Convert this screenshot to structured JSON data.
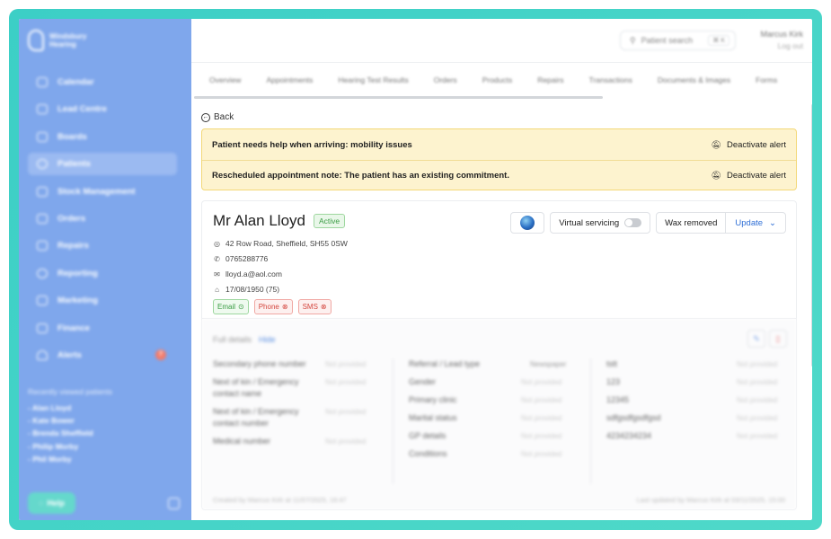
{
  "brand": {
    "name_line1": "Windsbury",
    "name_line2": "Hearing"
  },
  "sidebar": {
    "items": [
      {
        "label": "Calendar"
      },
      {
        "label": "Lead Centre"
      },
      {
        "label": "Boards"
      },
      {
        "label": "Patients"
      },
      {
        "label": "Stock Management"
      },
      {
        "label": "Orders"
      },
      {
        "label": "Repairs"
      },
      {
        "label": "Reporting"
      },
      {
        "label": "Marketing"
      },
      {
        "label": "Finance"
      },
      {
        "label": "Alerts",
        "badge": "7"
      }
    ],
    "recent_heading": "Recently viewed patients",
    "recent": [
      "- Alan Lloyd",
      "- Kate Bower",
      "- Brenda Sheffield",
      "- Philip Morby",
      "- Phil Morby"
    ],
    "help_label": "Help"
  },
  "header": {
    "search_placeholder": "Patient search",
    "search_shortcut": "⌘ K",
    "user_name": "Marcus Kirk",
    "logout_label": "Log out"
  },
  "tabs": [
    "Overview",
    "Appointments",
    "Hearing Test Results",
    "Orders",
    "Products",
    "Repairs",
    "Transactions",
    "Documents & Images",
    "Forms"
  ],
  "back_label": "Back",
  "alerts": [
    {
      "message": "Patient needs help when arriving: mobility issues",
      "action": "Deactivate alert"
    },
    {
      "message": "Rescheduled appointment note: The patient has an existing commitment.",
      "action": "Deactivate alert"
    }
  ],
  "patient": {
    "name": "Mr Alan Lloyd",
    "status": "Active",
    "address": "42 Row Road, Sheffield, SH55 0SW",
    "phone": "0765288776",
    "email": "lloyd.a@aol.com",
    "dob": "17/08/1950 (75)",
    "chips": {
      "email": "Email",
      "phone": "Phone",
      "sms": "SMS"
    }
  },
  "actions": {
    "virtual_servicing": "Virtual servicing",
    "wax_removed": "Wax removed",
    "update": "Update"
  },
  "details": {
    "heading": "Full details",
    "hide": "Hide",
    "col1": [
      {
        "label": "Secondary phone number",
        "value": "Not provided"
      },
      {
        "label": "Next of kin / Emergency contact name",
        "value": "Not provided"
      },
      {
        "label": "Next of kin / Emergency contact number",
        "value": "Not provided"
      },
      {
        "label": "Medical number",
        "value": "Not provided"
      }
    ],
    "col2": [
      {
        "label": "Referral / Lead type",
        "value": "Newspaper"
      },
      {
        "label": "Gender",
        "value": "Not provided"
      },
      {
        "label": "Primary clinic",
        "value": "Not provided"
      },
      {
        "label": "Marital status",
        "value": "Not provided"
      },
      {
        "label": "GP details",
        "value": "Not provided"
      },
      {
        "label": "Conditions",
        "value": "Not provided"
      }
    ],
    "col3": [
      {
        "label": "tstt",
        "value": "Not provided"
      },
      {
        "label": "123",
        "value": "Not provided"
      },
      {
        "label": "12345",
        "value": "Not provided"
      },
      {
        "label": "sdfgsdfgsdfgsd",
        "value": "Not provided"
      },
      {
        "label": "4234234234",
        "value": "Not provided"
      }
    ],
    "created": "Created by Marcus Kirk at 11/07/2025, 16:47",
    "updated": "Last updated by Marcus Kirk at 03/11/2025, 15:00"
  }
}
